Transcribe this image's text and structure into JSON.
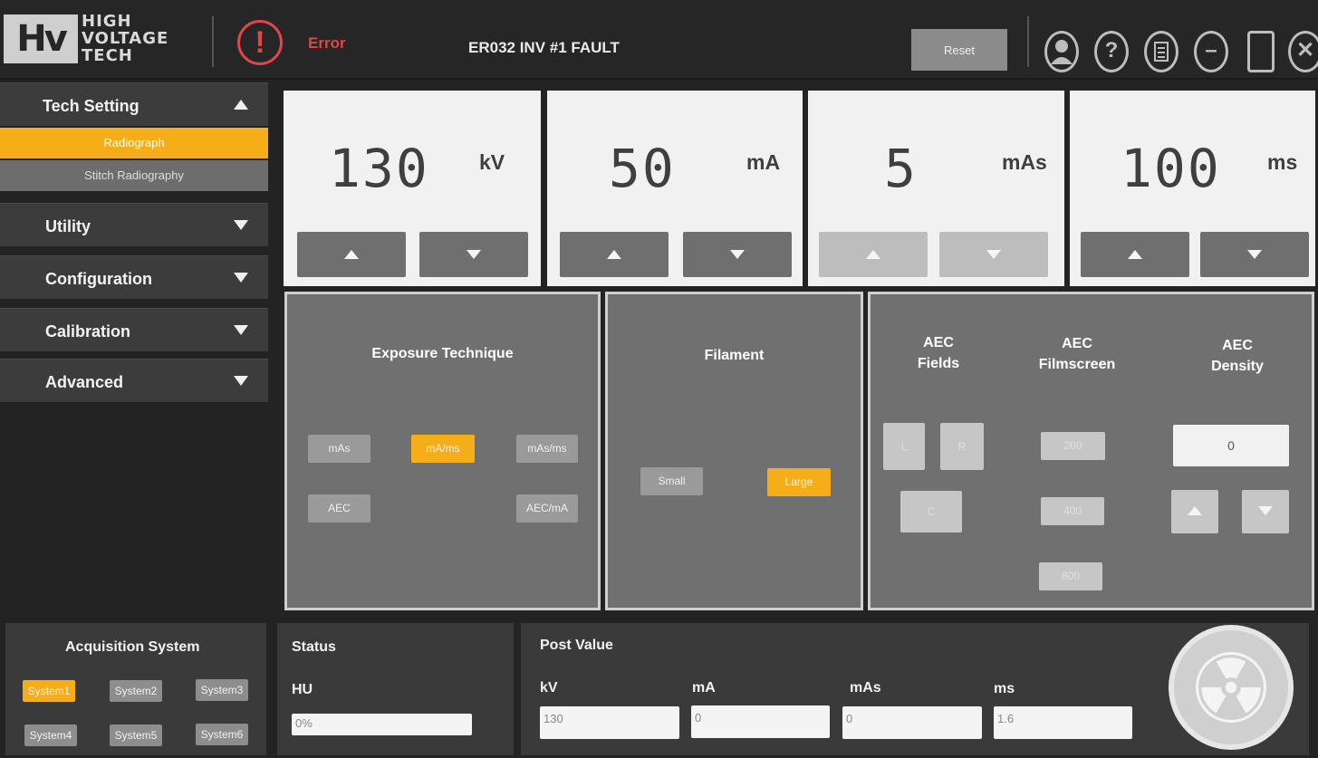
{
  "header": {
    "logo_mark": "Hv",
    "logo_line1": "HIGH",
    "logo_line2": "VOLTAGE",
    "logo_line3": "TECH",
    "error_label": "Error",
    "error_message": "ER032 INV #1 FAULT",
    "reset_label": "Reset",
    "icons": [
      "user-icon",
      "help-icon",
      "document-icon",
      "minimize-icon",
      "maximize-icon",
      "close-icon"
    ]
  },
  "sidebar": {
    "tech_setting": "Tech Setting",
    "sub_items": [
      "Radiograph",
      "Stitch Radiography"
    ],
    "menus": [
      "Utility",
      "Configuration",
      "Calibration",
      "Advanced"
    ]
  },
  "params": [
    {
      "value": "130",
      "unit": "kV"
    },
    {
      "value": "50",
      "unit": "mA"
    },
    {
      "value": "5",
      "unit": "mAs"
    },
    {
      "value": "100",
      "unit": "ms"
    }
  ],
  "exposure": {
    "title": "Exposure Technique",
    "options": [
      "mAs",
      "mA/ms",
      "mAs/ms",
      "AEC",
      "AEC/mA"
    ],
    "selected": "mA/ms"
  },
  "filament": {
    "title": "Filament",
    "options": [
      "Small",
      "Large"
    ],
    "selected": "Large"
  },
  "aec": {
    "fields_title_1": "AEC",
    "fields_title_2": "Fields",
    "filmscreen_title_1": "AEC",
    "filmscreen_title_2": "Filmscreen",
    "density_title_1": "AEC",
    "density_title_2": "Density",
    "fields": [
      "L",
      "R",
      "C"
    ],
    "filmscreen": [
      "200",
      "400",
      "800"
    ],
    "density_value": "0"
  },
  "acquisition": {
    "title": "Acquisition System",
    "systems": [
      "System1",
      "System2",
      "System3",
      "System4",
      "System5",
      "System6"
    ],
    "selected": "System1"
  },
  "status": {
    "title": "Status",
    "hu_label": "HU",
    "hu_value": "0%"
  },
  "post_value": {
    "title": "Post Value",
    "labels": [
      "kV",
      "mA",
      "mAs",
      "ms"
    ],
    "values": [
      "130",
      "0",
      "0",
      "1.6"
    ]
  },
  "colors": {
    "accent": "#f5ae17",
    "error": "#e0454a",
    "panel": "#707070"
  }
}
